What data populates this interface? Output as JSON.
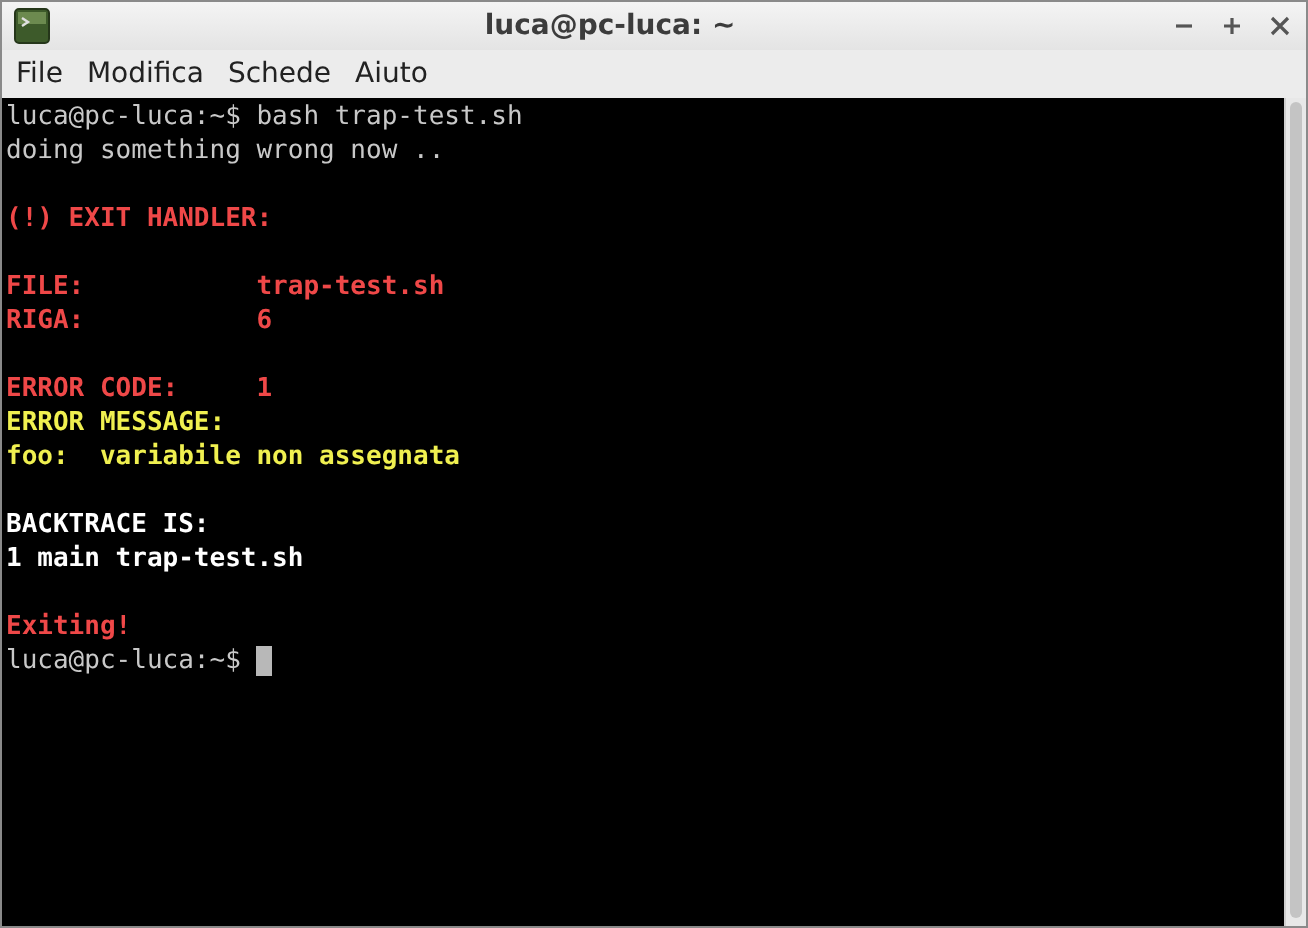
{
  "window": {
    "title": "luca@pc-luca: ~"
  },
  "menu": [
    "File",
    "Modifica",
    "Schede",
    "Aiuto"
  ],
  "terminal": {
    "lines": [
      {
        "kind": "plain",
        "text": "luca@pc-luca:~$ bash trap-test.sh"
      },
      {
        "kind": "plain",
        "text": "doing something wrong now .."
      },
      {
        "kind": "blank"
      },
      {
        "kind": "error",
        "text": "(!) EXIT HANDLER:"
      },
      {
        "kind": "blank"
      },
      {
        "kind": "error",
        "text": "FILE:           trap-test.sh"
      },
      {
        "kind": "error",
        "text": "RIGA:           6"
      },
      {
        "kind": "blank"
      },
      {
        "kind": "error",
        "text": "ERROR CODE:     1"
      },
      {
        "kind": "warning",
        "text": "ERROR MESSAGE:"
      },
      {
        "kind": "warning",
        "text": "foo:  variabile non assegnata"
      },
      {
        "kind": "blank"
      },
      {
        "kind": "info",
        "text": "BACKTRACE IS:"
      },
      {
        "kind": "info",
        "text": "1 main trap-test.sh"
      },
      {
        "kind": "blank"
      },
      {
        "kind": "error",
        "text": "Exiting!"
      },
      {
        "kind": "prompt",
        "text": "luca@pc-luca:~$"
      }
    ]
  }
}
